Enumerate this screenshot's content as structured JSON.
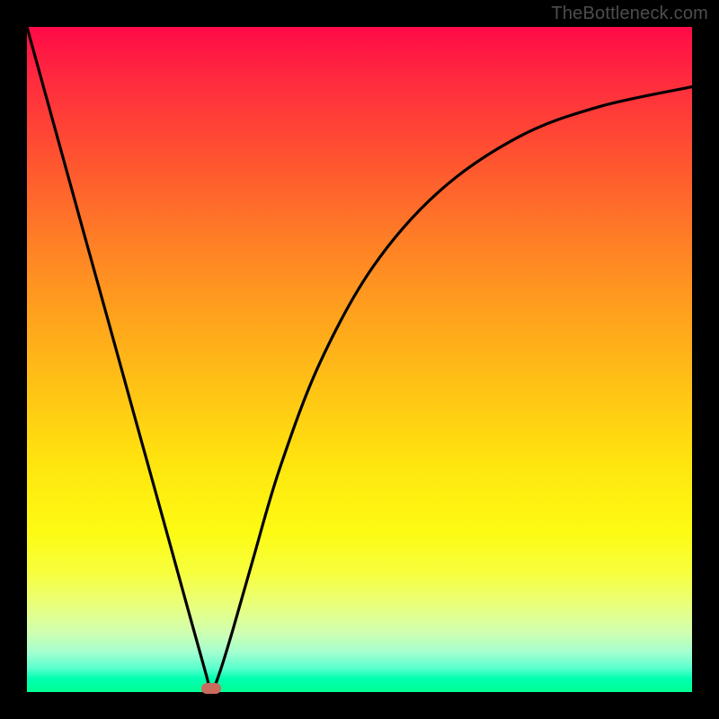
{
  "watermark": "TheBottleneck.com",
  "marker": {
    "x_frac": 0.277,
    "y_frac": 0.994,
    "color": "#cb6b5d"
  },
  "chart_data": {
    "type": "line",
    "title": "",
    "xlabel": "",
    "ylabel": "",
    "xlim": [
      0,
      1
    ],
    "ylim": [
      0,
      1
    ],
    "grid": false,
    "legend": false,
    "series": [
      {
        "name": "bottleneck-curve",
        "x": [
          0.0,
          0.04,
          0.08,
          0.12,
          0.16,
          0.2,
          0.24,
          0.27,
          0.277,
          0.29,
          0.31,
          0.34,
          0.38,
          0.44,
          0.52,
          0.62,
          0.74,
          0.86,
          1.0
        ],
        "y": [
          1.0,
          0.855,
          0.71,
          0.566,
          0.421,
          0.277,
          0.132,
          0.024,
          0.0,
          0.03,
          0.095,
          0.2,
          0.336,
          0.494,
          0.639,
          0.753,
          0.835,
          0.88,
          0.91
        ]
      }
    ],
    "annotations": []
  }
}
